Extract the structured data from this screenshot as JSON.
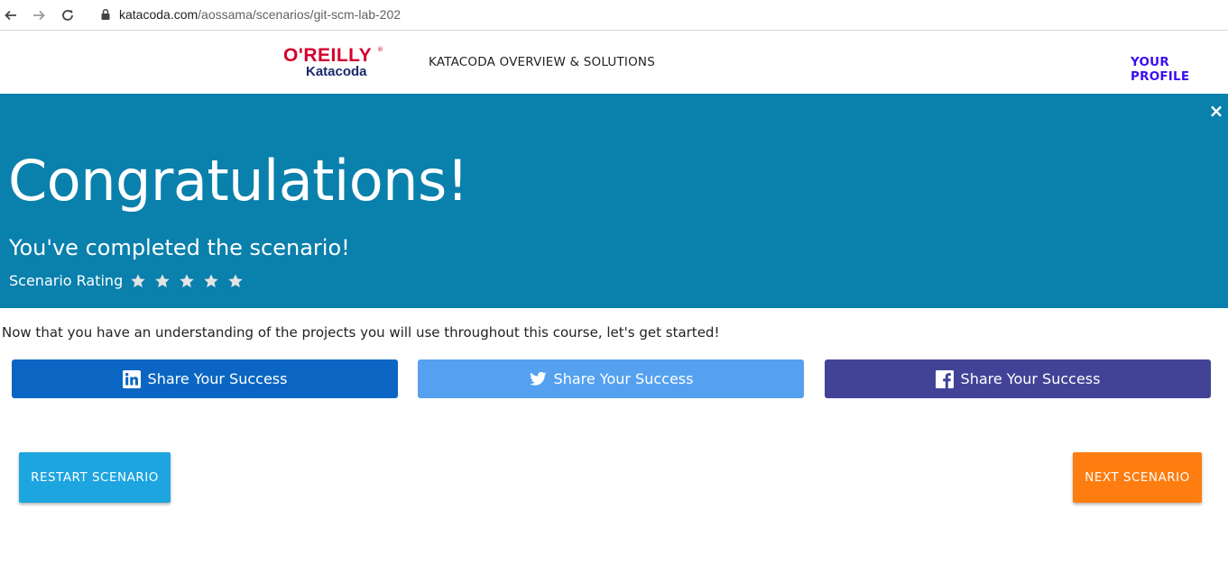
{
  "browser": {
    "url_domain": "katacoda.com",
    "url_path": "/aossama/scenarios/git-scm-lab-202"
  },
  "header": {
    "logo_top": "O'REILLY",
    "logo_bottom": "Katacoda",
    "nav_overview": "KATACODA OVERVIEW & SOLUTIONS",
    "nav_profile": "YOUR PROFILE"
  },
  "banner": {
    "close": "×",
    "title": "Congratulations!",
    "subtitle": "You've completed the scenario!",
    "rating_label": "Scenario Rating",
    "rating_stars_total": 5,
    "colors": {
      "background": "#0a80ac",
      "text": "#ffffff"
    }
  },
  "intro_text": "Now that you have an understanding of the projects you will use throughout this course, let's get started!",
  "share": {
    "linkedin": {
      "label": "Share Your Success",
      "icon": "linkedin-icon",
      "color": "#0a66c2"
    },
    "twitter": {
      "label": "Share Your Success",
      "icon": "twitter-icon",
      "color": "#55a1f0"
    },
    "facebook": {
      "label": "Share Your Success",
      "icon": "facebook-icon",
      "color": "#424397"
    }
  },
  "actions": {
    "restart": {
      "label": "RESTART SCENARIO",
      "color": "#1da5e0"
    },
    "next": {
      "label": "NEXT SCENARIO",
      "color": "#fd7d10"
    }
  }
}
